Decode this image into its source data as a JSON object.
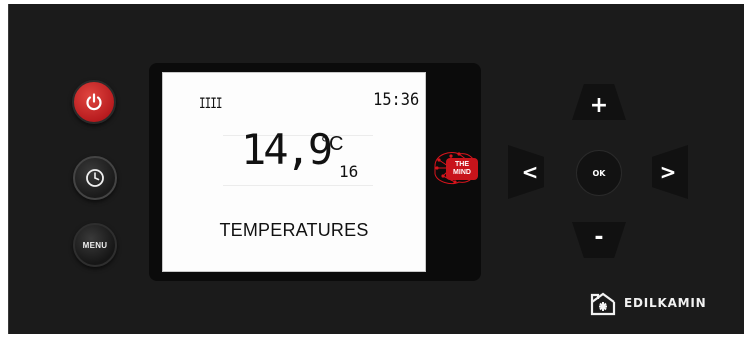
{
  "display": {
    "signal": "IIII",
    "time": "15:36",
    "temperature": "14,9",
    "unit": "°C",
    "secondary_value": "16",
    "label": "TEMPERATURES"
  },
  "buttons": {
    "power_icon": "power-icon",
    "clock_icon": "clock-icon",
    "menu_label": "MENU",
    "plus_label": "+",
    "minus_label": "-",
    "left_label": "<",
    "right_label": ">",
    "ok_label": "OK"
  },
  "logos": {
    "the_mind_line1": "THE",
    "the_mind_line2": "MIND",
    "brand_name": "EDILKAMIN"
  },
  "colors": {
    "panel": "#1b1b1b",
    "lcd_background": "#fdfdfd",
    "power_red": "#c8141b",
    "text_light": "#ffffff"
  }
}
